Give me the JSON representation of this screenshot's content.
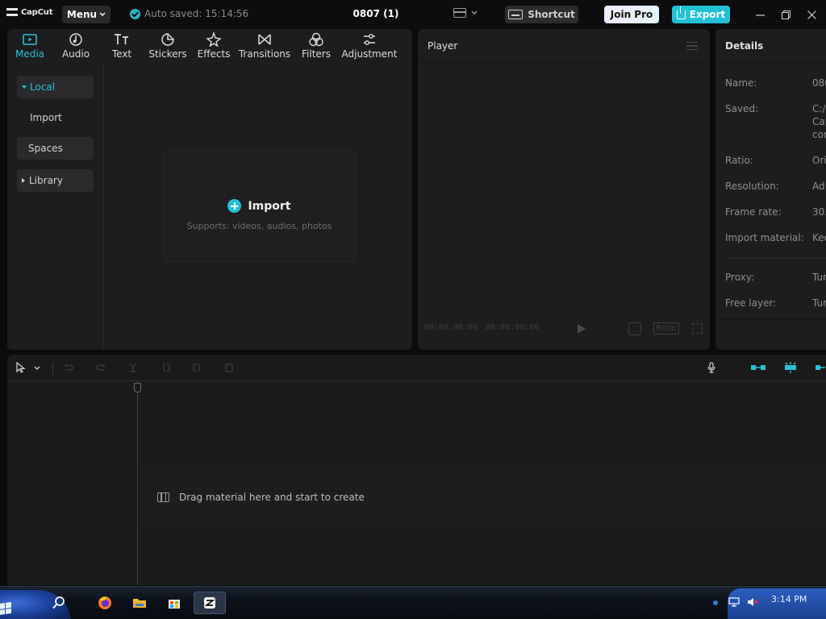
{
  "app": {
    "logo_text": "CapCut",
    "menu_label": "Menu",
    "autosave_text": "Auto saved: 15:14:56",
    "project_title": "0807 (1)",
    "shortcut_label": "Shortcut",
    "join_pro_label": "Join Pro",
    "export_label": "Export",
    "accent_color": "#22c1d6"
  },
  "media_toolbar": [
    {
      "label": "Media",
      "icon": "media-icon",
      "active": true
    },
    {
      "label": "Audio",
      "icon": "audio-icon",
      "active": false
    },
    {
      "label": "Text",
      "icon": "text-icon",
      "active": false
    },
    {
      "label": "Stickers",
      "icon": "stickers-icon",
      "active": false
    },
    {
      "label": "Effects",
      "icon": "effects-icon",
      "active": false
    },
    {
      "label": "Transitions",
      "icon": "transitions-icon",
      "active": false
    },
    {
      "label": "Filters",
      "icon": "filters-icon",
      "active": false
    },
    {
      "label": "Adjustment",
      "icon": "adjustment-icon",
      "active": false
    }
  ],
  "media_sidebar": {
    "local": "Local",
    "import": "Import",
    "spaces": "Spaces",
    "library": "Library"
  },
  "import_area": {
    "title": "Import",
    "subtitle": "Supports: videos, audios, photos"
  },
  "player": {
    "title": "Player",
    "current_time": "00:00:00:00",
    "total_time": "00:00:00:00",
    "ratio_label": "Ratio"
  },
  "details": {
    "title": "Details",
    "rows": [
      {
        "label": "Name:",
        "value": "080"
      },
      {
        "label": "Saved:",
        "value": "C:/"
      },
      {
        "label": "Ratio:",
        "value": "Ori"
      },
      {
        "label": "Resolution:",
        "value": "Ad"
      },
      {
        "label": "Frame rate:",
        "value": "30."
      },
      {
        "label": "Import material:",
        "value": "Kee"
      },
      {
        "label": "Proxy:",
        "value": "Tur"
      },
      {
        "label": "Free layer:",
        "value": "Tur"
      }
    ],
    "saved_extra_1": "Cap",
    "saved_extra_2": "con"
  },
  "timeline": {
    "drag_hint": "Drag material here and start to create"
  },
  "taskbar": {
    "clock": "3:14 PM"
  }
}
